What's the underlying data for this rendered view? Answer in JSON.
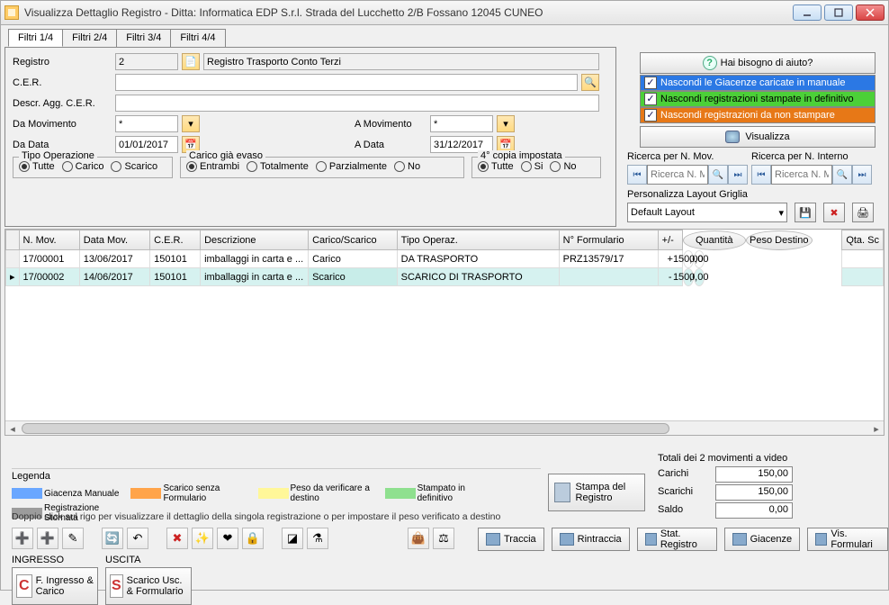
{
  "window": {
    "title": "Visualizza Dettaglio Registro - Ditta: Informatica EDP S.r.l. Strada del Lucchetto 2/B Fossano 12045 CUNEO"
  },
  "tabs": [
    "Filtri 1/4",
    "Filtri 2/4",
    "Filtri 3/4",
    "Filtri 4/4"
  ],
  "filters": {
    "registro_label": "Registro",
    "registro_value": "2",
    "registro_desc": "Registro Trasporto Conto Terzi",
    "cer_label": "C.E.R.",
    "cer_value": "",
    "descr_label": "Descr. Agg. C.E.R.",
    "descr_value": "",
    "da_mov_label": "Da Movimento",
    "da_mov_value": "*",
    "a_mov_label": "A Movimento",
    "a_mov_value": "*",
    "da_data_label": "Da Data",
    "da_data_value": "01/01/2017",
    "a_data_label": "A Data",
    "a_data_value": "31/12/2017"
  },
  "groups": {
    "tipo_operazione": {
      "legend": "Tipo Operazione",
      "options": [
        "Tutte",
        "Carico",
        "Scarico"
      ],
      "selected": "Tutte"
    },
    "carico_evaso": {
      "legend": "Carico già evaso",
      "options": [
        "Entrambi",
        "Totalmente",
        "Parzialmente",
        "No"
      ],
      "selected": "Entrambi"
    },
    "copia": {
      "legend": "4° copia impostata",
      "options": [
        "Tutte",
        "Si",
        "No"
      ],
      "selected": "Tutte"
    }
  },
  "help": {
    "button": "Hai bisogno di aiuto?",
    "stripes": [
      "Nascondi le Giacenze caricate in manuale",
      "Nascondi registrazioni stampate in definitivo",
      "Nascondi registrazioni da non stampare"
    ],
    "visualizza": "Visualizza"
  },
  "search": {
    "mov_label": "Ricerca per N. Mov.",
    "mov_placeholder": "Ricerca N. Mov",
    "int_label": "Ricerca per N. Interno",
    "int_placeholder": "Ricerca N. Mov"
  },
  "layout": {
    "label": "Personalizza Layout Griglia",
    "value": "Default Layout"
  },
  "grid": {
    "headers": [
      "N. Mov.",
      "Data Mov.",
      "C.E.R.",
      "Descrizione",
      "Carico/Scarico",
      "Tipo Operaz.",
      "N° Formulario",
      "+/-",
      "Quantità",
      "Peso Destino",
      "Qta. Sc"
    ],
    "rows": [
      {
        "nmov": "17/00001",
        "data": "13/06/2017",
        "cer": "150101",
        "descr": "imballaggi in carta e ...",
        "cs": "Carico",
        "tipo": "DA TRASPORTO",
        "form": "PRZ13579/17",
        "pm": "+",
        "qta": "150,00",
        "peso": "0,00"
      },
      {
        "nmov": "17/00002",
        "data": "14/06/2017",
        "cer": "150101",
        "descr": "imballaggi in carta e ...",
        "cs": "Scarico",
        "tipo": "SCARICO DI TRASPORTO",
        "form": "",
        "pm": "-",
        "qta": "150,00",
        "peso": "0,00"
      }
    ]
  },
  "totals": {
    "title": "Totali dei 2 movimenti a video",
    "rows": [
      {
        "label": "Carichi",
        "value": "150,00"
      },
      {
        "label": "Scarichi",
        "value": "150,00"
      },
      {
        "label": "Saldo",
        "value": "0,00"
      }
    ]
  },
  "legend": {
    "title": "Legenda",
    "items": [
      {
        "color": "#6aa7ff",
        "text": "Giacenza Manuale"
      },
      {
        "color": "#ffa44a",
        "text": "Scarico senza Formulario"
      },
      {
        "color": "#fff799",
        "text": "Peso da verificare a destino"
      },
      {
        "color": "#8fe08f",
        "text": "Stampato in definitivo"
      },
      {
        "color": "#9c9c9c",
        "text": "Registrazione Stornata"
      }
    ],
    "hint": "Doppio click sul rigo per visualizzare il dettaglio della singola registrazione o per impostare il peso verificato a destino"
  },
  "stampa": "Stampa del Registro",
  "action_buttons": [
    "Traccia",
    "Rintraccia",
    "Stat. Registro",
    "Giacenze",
    "Vis. Formulari"
  ],
  "bottom": {
    "ingresso_label": "INGRESSO",
    "uscita_label": "USCITA",
    "ingresso_btn": "F. Ingresso & Carico",
    "uscita_btn": "Scarico Usc. & Formulario",
    "ingresso_letter": "C",
    "uscita_letter": "S"
  },
  "toolbar_icons": [
    "add-red-icon",
    "add-green-icon",
    "edit-icon",
    "refresh-icon",
    "undo-icon",
    "delete-icon",
    "wand-icon",
    "heart-icon",
    "lock-icon",
    "erase-icon",
    "flask-icon",
    "bag-icon",
    "scale-icon"
  ]
}
